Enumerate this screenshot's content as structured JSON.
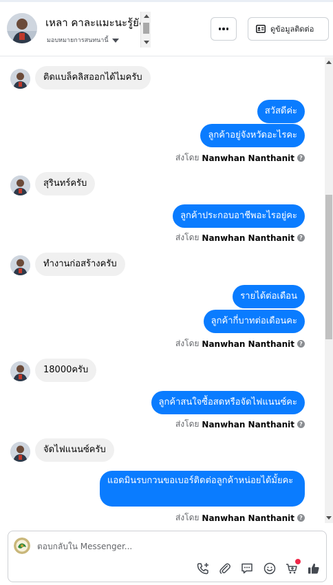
{
  "header": {
    "contact_name": "เหลา คาละแมะนะรู้ยัง",
    "assign_label": "มอบหมายการสนทนานี้",
    "more_button_icon": "more-dots-icon",
    "info_button_label": "ดูข้อมูลติดต่อ"
  },
  "messages": [
    {
      "side": "in",
      "text": "ติดแบล็คลิสออกได้ไมครับ"
    },
    {
      "side": "out",
      "text": "สวัสดีค่ะ"
    },
    {
      "side": "out",
      "text": "ลูกค้าอยู่จังหวัดอะไรคะ"
    },
    {
      "side": "sent_by",
      "prefix": "ส่งโดย",
      "name": "Nanwhan Nanthanit"
    },
    {
      "side": "in",
      "text": "สุรินทร์ครับ"
    },
    {
      "side": "out",
      "text": "ลูกค้าประกอบอาชีพอะไรอยู่คะ"
    },
    {
      "side": "sent_by",
      "prefix": "ส่งโดย",
      "name": "Nanwhan Nanthanit"
    },
    {
      "side": "in",
      "text": "ทำงานก่อสร้างครับ"
    },
    {
      "side": "out",
      "text": "รายได้ต่อเดือน"
    },
    {
      "side": "out",
      "text": "ลูกค้ากี่บาทต่อเดือนคะ"
    },
    {
      "side": "sent_by",
      "prefix": "ส่งโดย",
      "name": "Nanwhan Nanthanit"
    },
    {
      "side": "in",
      "text": "18000ครับ"
    },
    {
      "side": "out",
      "text": "ลูกค้าสนใจซื้อสดหรือจัดไฟแนนซ์คะ"
    },
    {
      "side": "sent_by",
      "prefix": "ส่งโดย",
      "name": "Nanwhan Nanthanit"
    },
    {
      "side": "in",
      "text": "จัดไฟแนนซ์ครับ"
    },
    {
      "side": "out",
      "text": "แอดมินรบกวนขอเบอร์ติดต่อลูกค้าหน่อยได้มั้ยคะ"
    },
    {
      "side": "sent_by",
      "prefix": "ส่งโดย",
      "name": "Nanwhan Nanthanit"
    }
  ],
  "composer": {
    "placeholder": "ตอบกลับใน Messenger...",
    "tools": [
      "phone-plus-icon",
      "paperclip-icon",
      "message-icon",
      "emoji-icon",
      "cart-icon",
      "thumbs-up-icon"
    ]
  },
  "colors": {
    "outgoing_bubble": "#0a7cff",
    "incoming_bubble": "#f0f0f0",
    "notification_dot": "#f02849"
  }
}
